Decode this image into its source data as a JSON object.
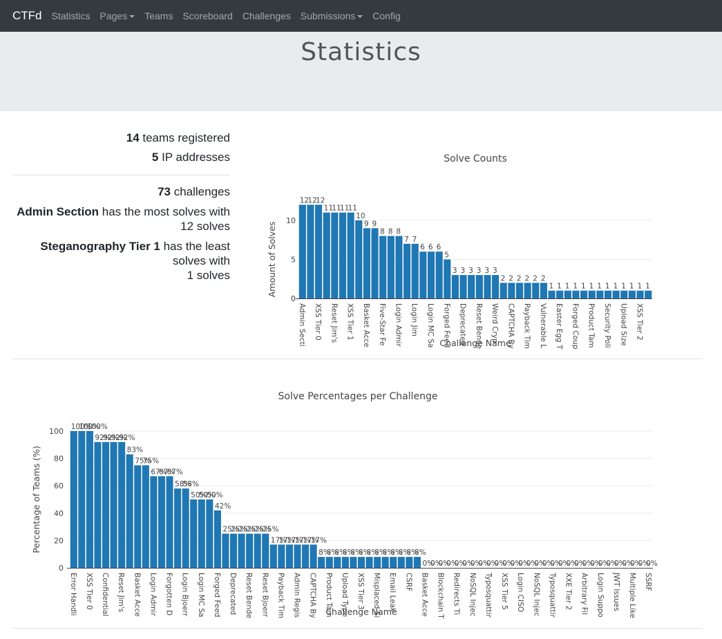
{
  "navbar": {
    "brand": "CTFd",
    "items": [
      {
        "label": "Statistics",
        "dropdown": false
      },
      {
        "label": "Pages",
        "dropdown": true
      },
      {
        "label": "Teams",
        "dropdown": false
      },
      {
        "label": "Scoreboard",
        "dropdown": false
      },
      {
        "label": "Challenges",
        "dropdown": false
      },
      {
        "label": "Submissions",
        "dropdown": true
      },
      {
        "label": "Config",
        "dropdown": false
      }
    ]
  },
  "page_title": "Statistics",
  "stats": {
    "teams_count": "14",
    "teams_text": " teams registered",
    "ip_count": "5",
    "ip_text": " IP addresses",
    "challenges_count": "73",
    "challenges_text": " challenges",
    "most_solved_name": "Admin Section",
    "most_solved_text1": " has the most solves with",
    "most_solved_text2": "12 solves",
    "least_solved_name": "Steganography Tier 1",
    "least_solved_text1": " has the least",
    "least_solved_text2": "solves with",
    "least_solved_text3": "1 solves"
  },
  "colors": {
    "bar": "#1f77b4",
    "navbar": "#343a40",
    "jumbotron": "#e9ecef"
  },
  "chart_data": [
    {
      "type": "bar",
      "title": "Solve Counts",
      "xlabel": "Challenge Name",
      "ylabel": "Amount of Solves",
      "ylim": [
        0,
        12.6
      ],
      "yticks": [
        0,
        5,
        10
      ],
      "grid": true,
      "categories": [
        "Admin Secti",
        "",
        "XSS Tier 0",
        "",
        "Reset Jim's",
        "",
        "XSS Tier 1",
        "",
        "Basket Acce",
        "",
        "Five-Star Fe",
        "",
        "Login Admir",
        "",
        "Login Jim",
        "",
        "Login MC Sa",
        "",
        "Forged Feed",
        "",
        "Deprecated",
        "",
        "Reset Bende",
        "",
        "Weird Cryp",
        "",
        "CAPTCHA By",
        "",
        "Payback Tim",
        "",
        "Vulnerable L",
        "",
        "Easter Egg T",
        "",
        "Forged Coup",
        "",
        "Product Tam",
        "",
        "Security Poli",
        "",
        "Upload Size",
        "",
        "XSS Tier 2",
        ""
      ],
      "values": [
        12,
        12,
        12,
        11,
        11,
        11,
        11,
        10,
        9,
        9,
        8,
        8,
        8,
        7,
        7,
        6,
        6,
        6,
        5,
        3,
        3,
        3,
        3,
        3,
        3,
        2,
        2,
        2,
        2,
        2,
        2,
        1,
        1,
        1,
        1,
        1,
        1,
        1,
        1,
        1,
        1,
        1,
        1,
        1
      ],
      "data_labels": [
        "12",
        "12",
        "12",
        "11",
        "11",
        "11",
        "11",
        "10",
        "9",
        "9",
        "8",
        "8",
        "8",
        "7",
        "7",
        "6",
        "6",
        "6",
        "5",
        "3",
        "3",
        "3",
        "3",
        "3",
        "3",
        "2",
        "2",
        "2",
        "2",
        "2",
        "2",
        "1",
        "1",
        "1",
        "1",
        "1",
        "1",
        "1",
        "1",
        "1",
        "1",
        "1",
        "1",
        "1"
      ]
    },
    {
      "type": "bar",
      "title": "Solve Percentages per Challenge",
      "xlabel": "Challenge Name",
      "ylabel": "Percentage of Teams (%)",
      "ylim": [
        0,
        105
      ],
      "yticks": [
        0,
        20,
        40,
        60,
        80,
        100
      ],
      "grid": true,
      "categories": [
        "Error Handli",
        "",
        "XSS Tier 0",
        "",
        "Confidential",
        "",
        "Reset Jim's",
        "",
        "Basket Acce",
        "",
        "Login Admir",
        "",
        "Forgotten D",
        "",
        "Login Bjoerr",
        "",
        "Login MC Sa",
        "",
        "Forged Feed",
        "",
        "Deprecated",
        "",
        "Reset Bende",
        "",
        "Reset Bjoerr",
        "",
        "Payback Tim",
        "",
        "Admin Regis",
        "",
        "CAPTCHA By",
        "",
        "Product Tam",
        "",
        "Upload Type",
        "",
        "XSS Tier 3",
        "",
        "Misplaced Si",
        "",
        "Email Leak",
        "",
        "CSRF",
        "",
        "Basket Acce",
        "",
        "Blockchain T",
        "",
        "Redirects Ti",
        "",
        "NoSQL Injec",
        "",
        "Typosquattir",
        "",
        "XSS Tier 5",
        "",
        "Login CISO",
        "",
        "NoSQL Injec",
        "",
        "Typosquattir",
        "",
        "XXE Tier 2",
        "",
        "Arbitrary Fil",
        "",
        "Login Suppo",
        "",
        "JWT Issues",
        "",
        "Multiple Like",
        "",
        "SSRF"
      ],
      "values": [
        100,
        100,
        100,
        92,
        92,
        92,
        92,
        83,
        75,
        75,
        67,
        67,
        67,
        58,
        58,
        50,
        50,
        50,
        42,
        25,
        25,
        25,
        25,
        25,
        25,
        17,
        17,
        17,
        17,
        17,
        17,
        8,
        8,
        8,
        8,
        8,
        8,
        8,
        8,
        8,
        8,
        8,
        8,
        8,
        0,
        0,
        0,
        0,
        0,
        0,
        0,
        0,
        0,
        0,
        0,
        0,
        0,
        0,
        0,
        0,
        0,
        0,
        0,
        0,
        0,
        0,
        0,
        0,
        0,
        0,
        0,
        0,
        0
      ],
      "data_labels_suffix": "%"
    }
  ]
}
